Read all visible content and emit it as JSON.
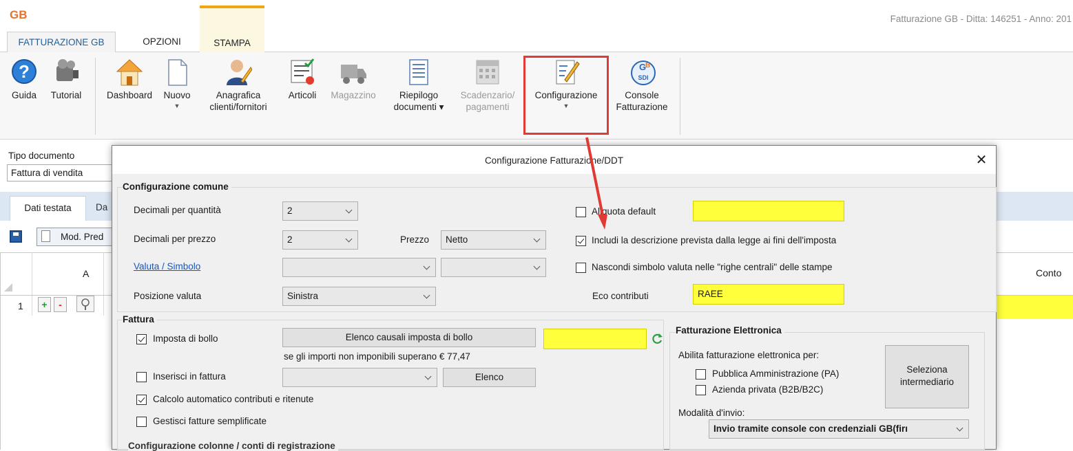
{
  "app": {
    "logo_text": "GB",
    "window_title": "Fatturazione GB - Ditta: 146251 - Anno: 201"
  },
  "menu_tabs": [
    "FATTURAZIONE GB",
    "OPZIONI",
    "STAMPA"
  ],
  "ribbon": {
    "guida": "Guida",
    "tutorial": "Tutorial",
    "dashboard": "Dashboard",
    "nuovo": "Nuovo",
    "anagrafica_1": "Anagrafica",
    "anagrafica_2": "clienti/fornitori",
    "articoli": "Articoli",
    "magazzino": "Magazzino",
    "riepilogo_1": "Riepilogo",
    "riepilogo_2": "documenti ▾",
    "scadenzario_1": "Scadenzario/",
    "scadenzario_2": "pagamenti",
    "configurazione": "Configurazione",
    "console_1": "Console",
    "console_2": "Fatturazione",
    "sdi_badge": "SDI"
  },
  "form": {
    "tipo_label": "Tipo documento",
    "tipo_value": "Fattura di vendita",
    "tab_dati": "Dati testata",
    "tab_da": "Da",
    "mod_pred": "Mod. Pred",
    "col_a": "A",
    "col_conto": "Conto",
    "row_num": "1",
    "plus": "+",
    "minus": "-"
  },
  "dialog": {
    "title": "Configurazione Fatturazione/DDT",
    "close": "✕",
    "comune": {
      "title": "Configurazione comune",
      "dec_qta_label": "Decimali per quantità",
      "dec_qta_value": "2",
      "dec_prezzo_label": "Decimali per prezzo",
      "dec_prezzo_value": "2",
      "prezzo_label": "Prezzo",
      "prezzo_value": "Netto",
      "valuta_label": "Valuta / Simbolo",
      "posizione_label": "Posizione valuta",
      "posizione_value": "Sinistra",
      "aliquota_label": "Aliquota default",
      "includi_label": "Includi la descrizione prevista dalla legge ai fini dell'imposta",
      "nascondi_label": "Nascondi simbolo valuta nelle \"righe centrali\" delle stampe",
      "eco_label": "Eco contributi",
      "eco_value": "RAEE"
    },
    "fattura": {
      "title": "Fattura",
      "bollo_label": "Imposta di bollo",
      "elenco_causali": "Elenco causali imposta di bollo",
      "bollo_note": "se gli importi non imponibili superano € 77,47",
      "inserisci_label": "Inserisci in fattura",
      "elenco_btn": "Elenco",
      "calcolo_label": "Calcolo automatico contributi e ritenute",
      "semplificate_label": "Gestisci fatture semplificate"
    },
    "elettronica": {
      "title": "Fatturazione Elettronica",
      "abilita_label": "Abilita fatturazione elettronica per:",
      "pa_label": "Pubblica Amministrazione (PA)",
      "b2b_label": "Azienda privata (B2B/B2C)",
      "seleziona_1": "Seleziona",
      "seleziona_2": "intermediario",
      "modalita_label": "Modalità d'invio:",
      "modalita_value": "Invio tramite console con credenziali GB(firı"
    },
    "colonne_title": "Configurazione colonne / conti di registrazione"
  },
  "colors": {
    "highlight": "#e23b35",
    "yellow_field": "#ffff3c",
    "accent_tab": "#f2a413"
  }
}
